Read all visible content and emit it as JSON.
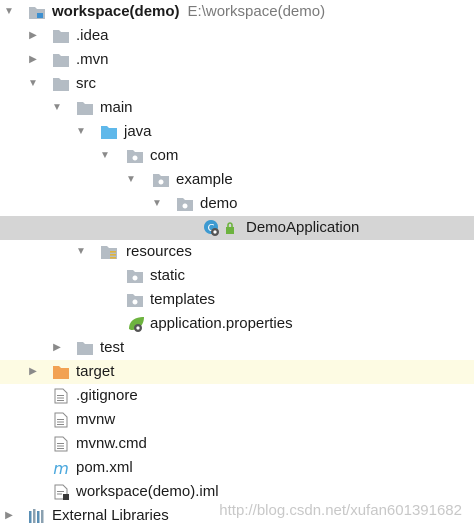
{
  "tree": {
    "root_name": "workspace(demo)",
    "root_path": "E:\\workspace(demo)",
    "idea": ".idea",
    "mvn": ".mvn",
    "src": "src",
    "main": "main",
    "java": "java",
    "com": "com",
    "example": "example",
    "demo": "demo",
    "demo_application": "DemoApplication",
    "resources": "resources",
    "static": "static",
    "templates": "templates",
    "application_properties": "application.properties",
    "test": "test",
    "target": "target",
    "gitignore": ".gitignore",
    "mvnw": "mvnw",
    "mvnw_cmd": "mvnw.cmd",
    "pom": "pom.xml",
    "iml": "workspace(demo).iml",
    "external_libraries": "External Libraries"
  },
  "watermark": "http://blog.csdn.net/xufan601391682",
  "colors": {
    "folder_gray": "#b4bcc4",
    "folder_source": "#5fb8ea",
    "folder_excluded": "#f2a253",
    "selection": "#d5d5d5",
    "excluded_row": "#fdfbe3",
    "spring_green": "#6db33f"
  }
}
